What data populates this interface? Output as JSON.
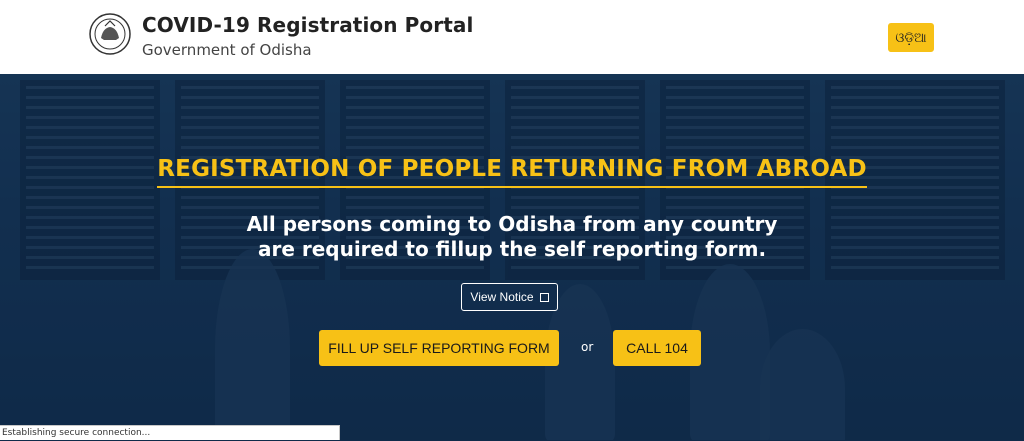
{
  "header": {
    "title": "COVID-19 Registration Portal",
    "subtitle": "Government of Odisha",
    "emblem_icon": "odisha-state-emblem",
    "language_button": "ଓଡ଼ିଆ"
  },
  "hero": {
    "heading": "REGISTRATION OF PEOPLE RETURNING FROM ABROAD",
    "line1": "All persons coming to Odisha from any country",
    "line2": "are required to fillup the self reporting form.",
    "view_notice": "View Notice",
    "view_notice_icon": "external-link-icon",
    "primary_cta": "FILL UP SELF REPORTING FORM",
    "or_text": "or",
    "call_cta": "CALL 104"
  },
  "status_bar": {
    "text": "Establishing secure connection..."
  },
  "colors": {
    "accent": "#f7c116",
    "hero_bg": "#163556",
    "header_bg": "#ffffff"
  }
}
